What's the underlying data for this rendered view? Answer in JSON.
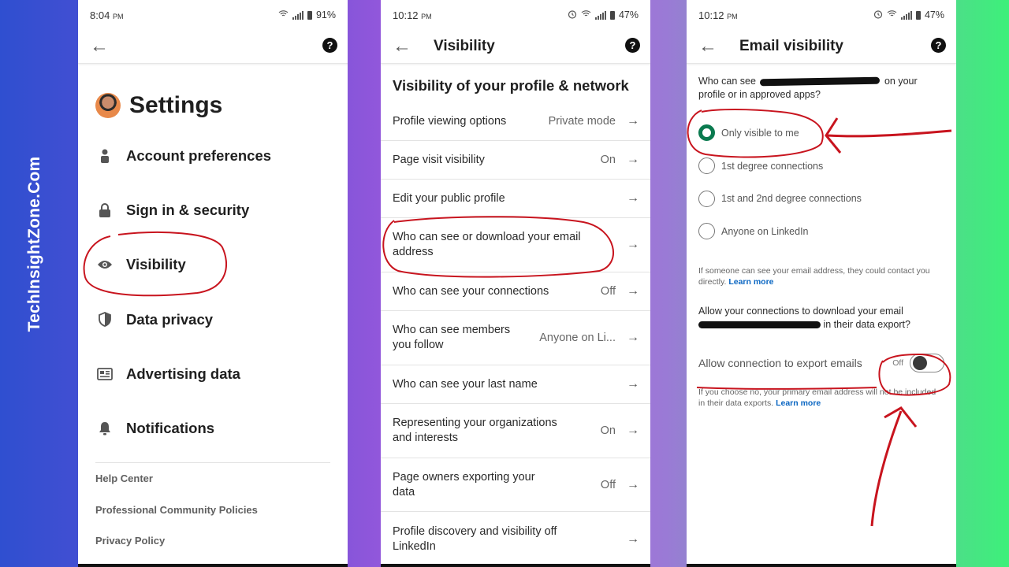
{
  "brand": {
    "text": "TechInsightZone.Com"
  },
  "panel1": {
    "status": {
      "time": "8:04",
      "ampm": "PM",
      "battery": "91%"
    },
    "title": "Settings",
    "menu": [
      {
        "label": "Account preferences",
        "icon": "person-icon"
      },
      {
        "label": "Sign in & security",
        "icon": "lock-icon"
      },
      {
        "label": "Visibility",
        "icon": "eye-icon"
      },
      {
        "label": "Data privacy",
        "icon": "shield-icon"
      },
      {
        "label": "Advertising data",
        "icon": "newspaper-icon"
      },
      {
        "label": "Notifications",
        "icon": "bell-icon"
      }
    ],
    "footer": [
      "Help Center",
      "Professional Community Policies",
      "Privacy Policy"
    ]
  },
  "panel2": {
    "status": {
      "time": "10:12",
      "ampm": "PM",
      "battery": "47%"
    },
    "title": "Visibility",
    "section_title": "Visibility of your profile & network",
    "rows": [
      {
        "label": "Profile viewing options",
        "value": "Private mode"
      },
      {
        "label": "Page visit visibility",
        "value": "On"
      },
      {
        "label": "Edit your public profile",
        "value": ""
      },
      {
        "label": "Who can see or download your email address",
        "value": ""
      },
      {
        "label": "Who can see your connections",
        "value": "Off"
      },
      {
        "label": "Who can see members you follow",
        "value": "Anyone on Li..."
      },
      {
        "label": "Who can see your last name",
        "value": ""
      },
      {
        "label": "Representing your organizations and interests",
        "value": "On"
      },
      {
        "label": "Page owners exporting your data",
        "value": "Off"
      },
      {
        "label": "Profile discovery and visibility off LinkedIn",
        "value": ""
      }
    ]
  },
  "panel3": {
    "status": {
      "time": "10:12",
      "ampm": "PM",
      "battery": "47%"
    },
    "title": "Email visibility",
    "question_pre": "Who can see",
    "question_post": "on your profile or in approved apps?",
    "options": [
      {
        "label": "Only visible to me",
        "selected": true
      },
      {
        "label": "1st degree connections",
        "selected": false
      },
      {
        "label": "1st and 2nd degree connections",
        "selected": false
      },
      {
        "label": "Anyone on LinkedIn",
        "selected": false
      }
    ],
    "note1": "If someone can see your email address, they could contact you directly.",
    "learn_more": "Learn more",
    "question2_pre": "Allow your connections to download your email",
    "question2_post": "in their data export?",
    "toggle_label": "Allow connection to export emails",
    "toggle_state": "Off",
    "note2": "If you choose no, your primary email address will not be included in their data exports.",
    "accent_color": "#0a7a4f",
    "link_color": "#0a66c2"
  }
}
